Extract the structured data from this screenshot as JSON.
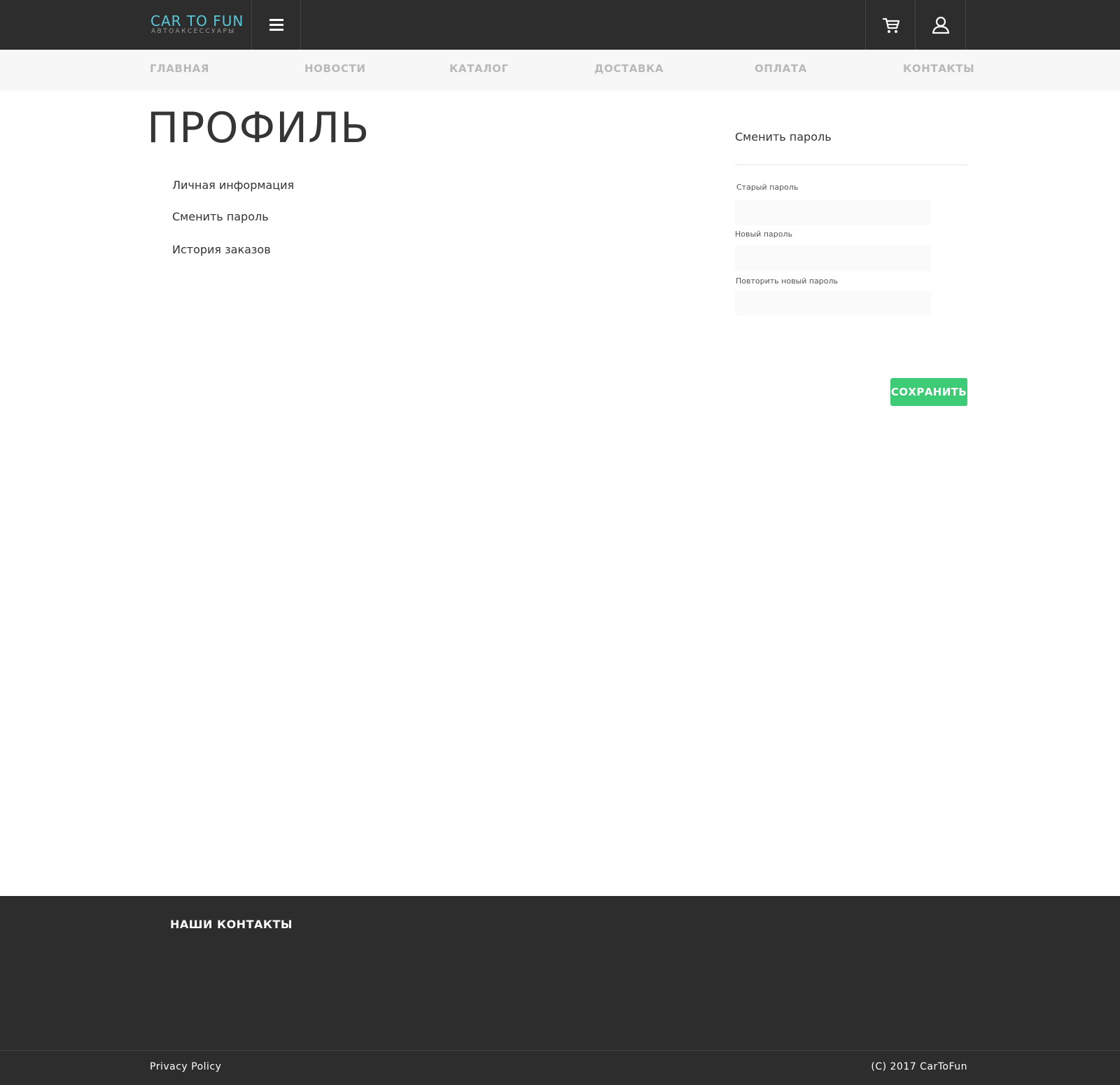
{
  "header": {
    "logo_title": "CAR TO FUN",
    "logo_subtitle": "АВТОАКСЕССУАРЫ",
    "menu_icon": "hamburger-icon",
    "cart_icon": "cart-icon",
    "user_icon": "user-icon"
  },
  "nav": {
    "items": [
      {
        "label": "ГЛАВНАЯ"
      },
      {
        "label": "НОВОСТИ"
      },
      {
        "label": "КАТАЛОГ"
      },
      {
        "label": "ДОСТАВКА"
      },
      {
        "label": "ОПЛАТА"
      },
      {
        "label": "КОНТАКТЫ"
      }
    ]
  },
  "main": {
    "page_title": "ПРОФИЛЬ",
    "side_links": [
      {
        "label": "Личная информация"
      },
      {
        "label": "Сменить пароль"
      },
      {
        "label": "История заказов"
      }
    ],
    "form": {
      "title": "Сменить пароль",
      "fields": [
        {
          "label": "Старый пароль",
          "value": ""
        },
        {
          "label": "Новый пароль",
          "value": ""
        },
        {
          "label": "Повторить новый пароль",
          "value": ""
        }
      ],
      "submit_label": "СОХРАНИТЬ"
    }
  },
  "footer": {
    "heading": "НАШИ КОНТАКТЫ",
    "privacy_link": "Privacy Policy",
    "copyright": "(C) 2017 CarToFun"
  },
  "colors": {
    "header_bg": "#2d2d2d",
    "logo_accent": "#5bc8d9",
    "nav_bg": "#f7f7f7",
    "nav_text": "#b9b9b9",
    "save_button": "#3ecb76"
  }
}
